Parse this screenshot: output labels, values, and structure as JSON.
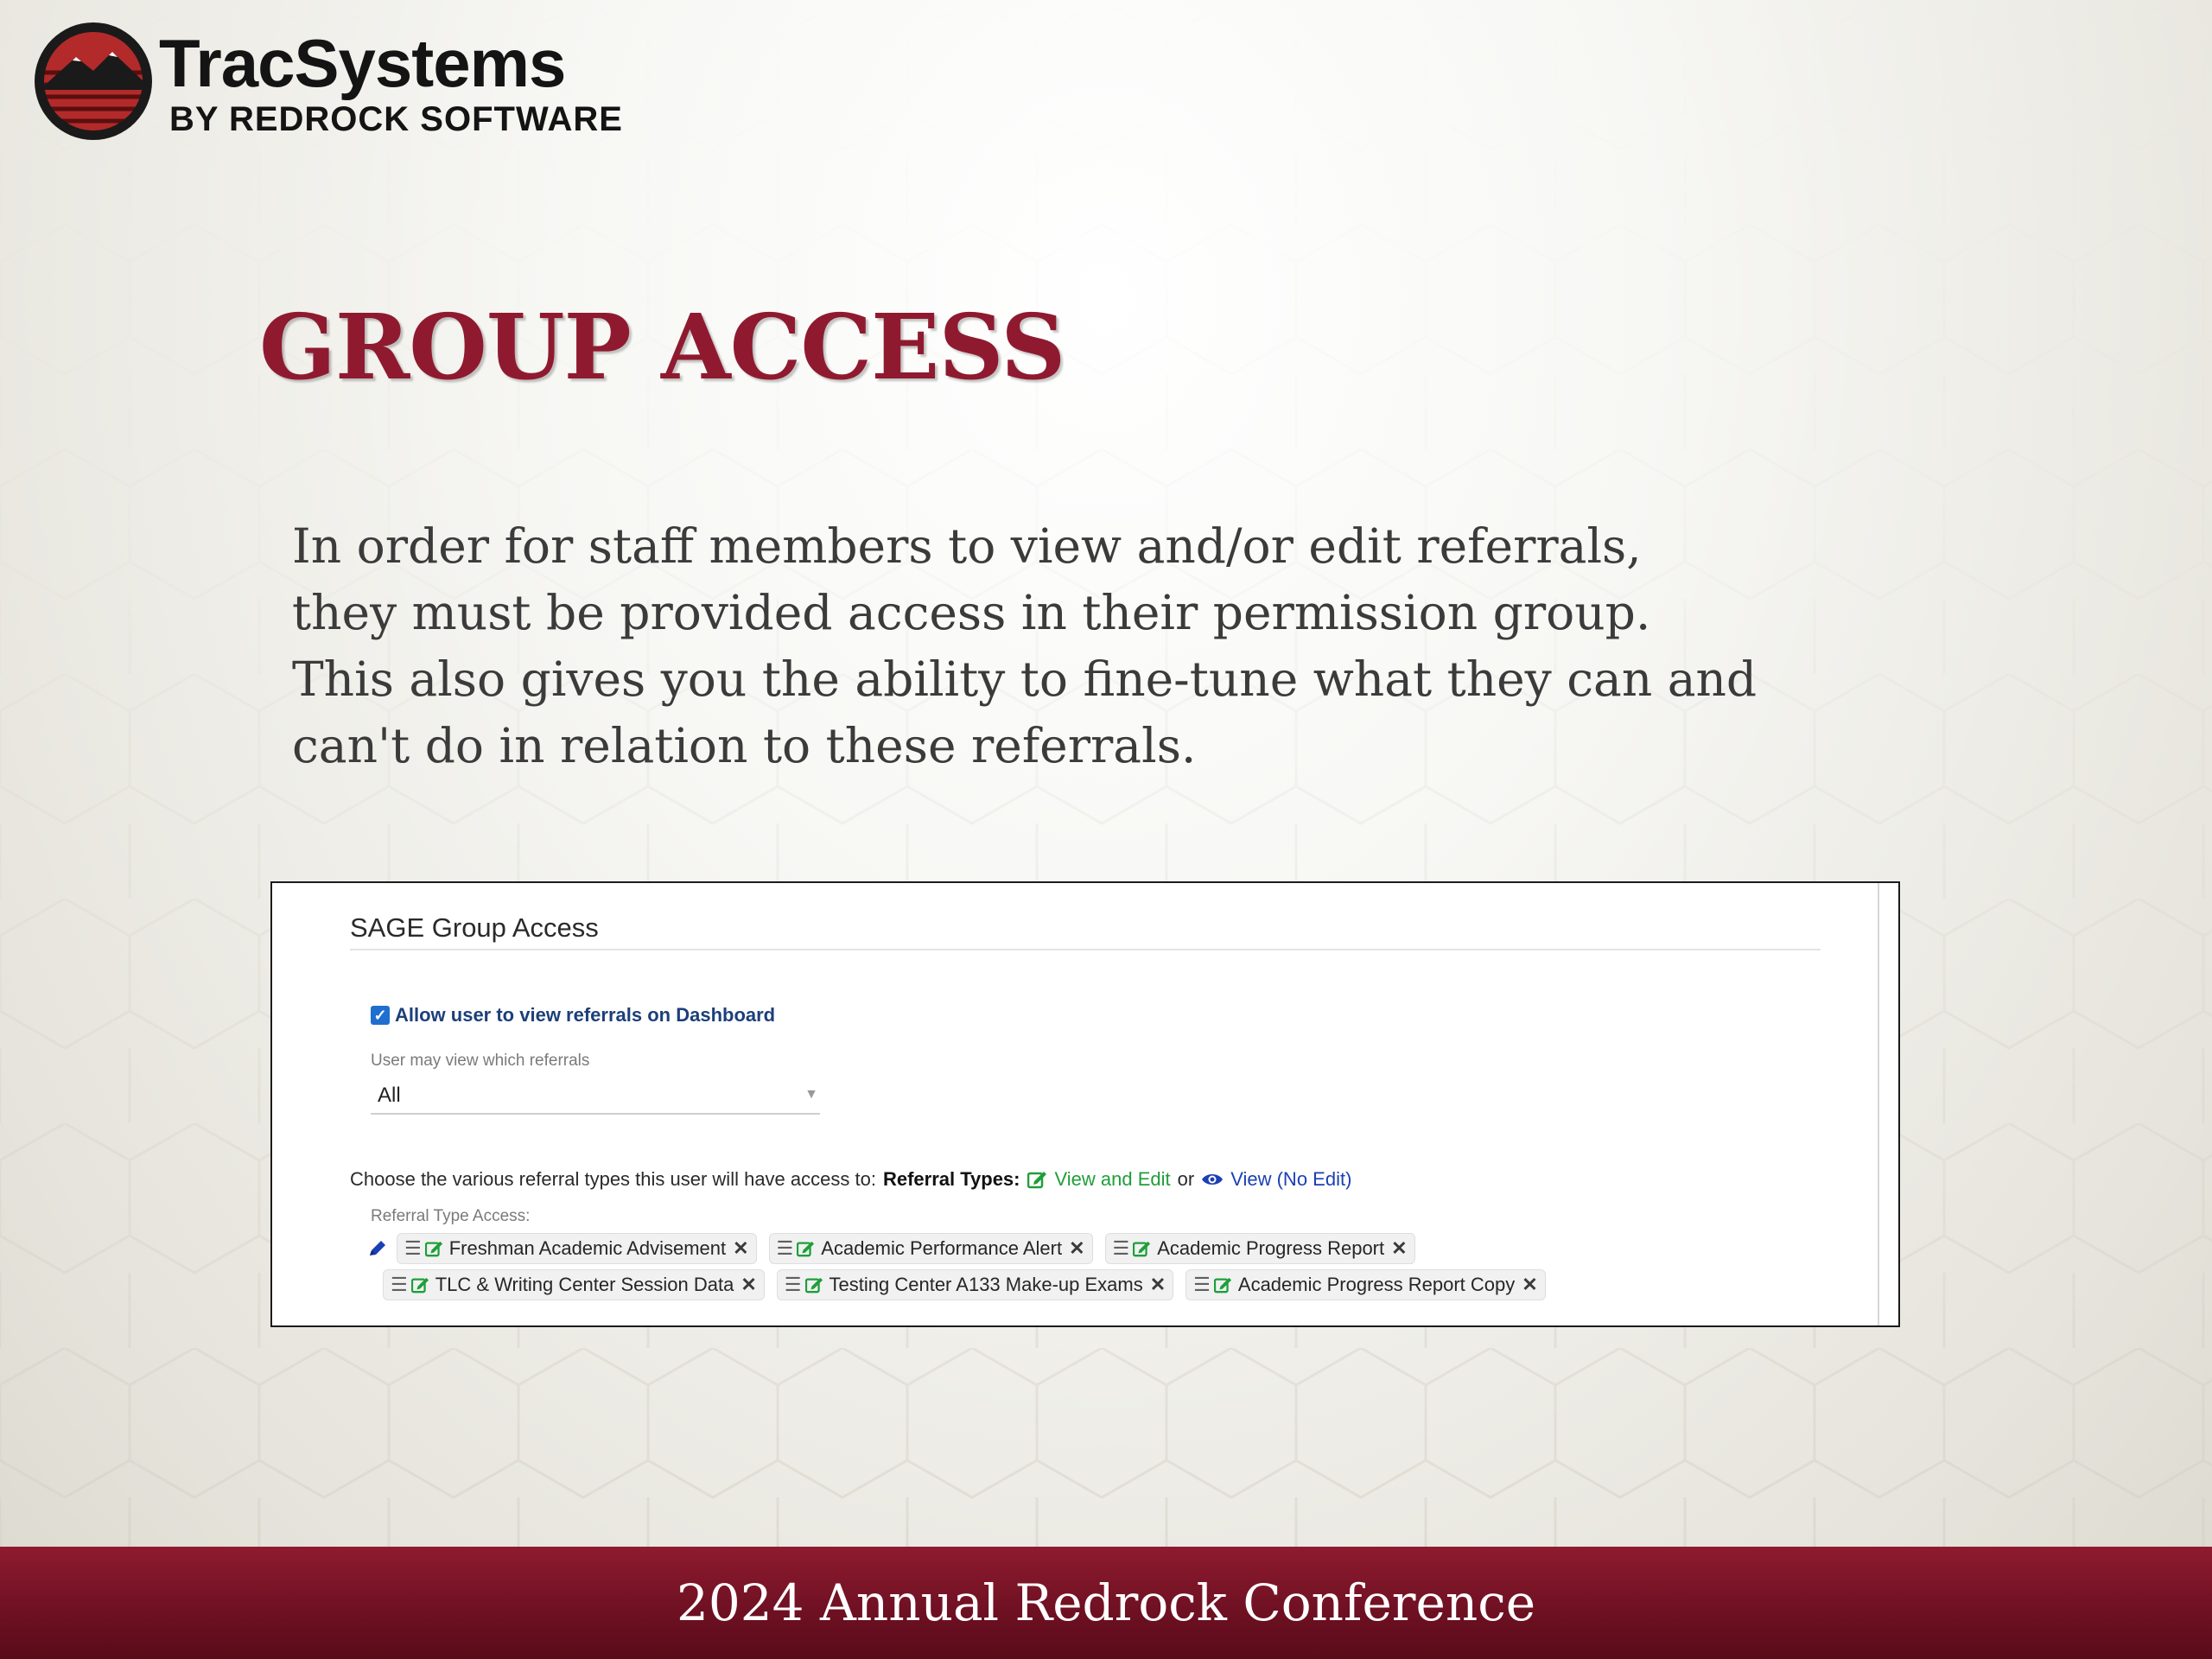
{
  "logo": {
    "title": "TracSystems",
    "subtitle": "BY REDROCK SOFTWARE",
    "icon": "mountain-sun-badge-icon"
  },
  "slide": {
    "title": "GROUP ACCESS",
    "body_lines": [
      "In order for staff members to view and/or edit referrals,",
      "they must be provided access in their permission group.",
      "This also gives you the ability to fine-tune what they can and",
      "can't do in relation to these referrals."
    ]
  },
  "panel": {
    "title": "SAGE Group Access",
    "checkbox_label": "Allow user to view referrals on Dashboard",
    "checkbox_checked": true,
    "select_caption": "User may view which referrals",
    "select_value": "All",
    "choose_text": "Choose the various referral types this user will have access to:",
    "referral_types_label": "Referral Types",
    "view_edit_label": "View and Edit",
    "or_text": "or",
    "view_no_edit_label": "View (No Edit)",
    "access_caption": "Referral Type Access:",
    "chips_row1": [
      "Freshman Academic Advisement",
      "Academic Performance Alert",
      "Academic Progress Report"
    ],
    "chips_row2": [
      "TLC & Writing Center Session Data",
      "Testing Center A133 Make-up Exams",
      "Academic Progress Report Copy"
    ]
  },
  "footer": {
    "text": "2024 Annual Redrock Conference"
  },
  "colors": {
    "title_red": "#8f1a2f",
    "footer_red": "#7a1527",
    "edit_green": "#1e9e3a",
    "view_blue": "#1b3fb5",
    "checkbox_blue": "#1e6fd0"
  }
}
